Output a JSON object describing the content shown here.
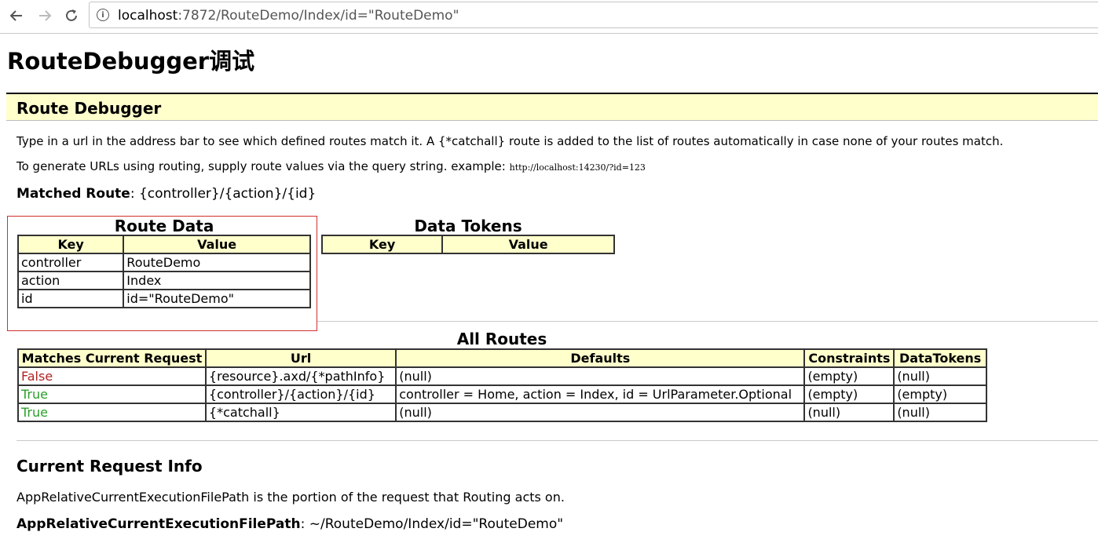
{
  "browser": {
    "url_host": "localhost",
    "url_rest": ":7872/RouteDemo/Index/id=\"RouteDemo\""
  },
  "page_title": "RouteDebugger调试",
  "route_debugger": {
    "heading": "Route Debugger",
    "intro": "Type in a url in the address bar to see which defined routes match it. A {*catchall} route is added to the list of routes automatically in case none of your routes match.",
    "gen_text": "To generate URLs using routing, supply route values via the query string. example: ",
    "gen_example": "http://localhost:14230/?id=123",
    "matched_label": "Matched Route",
    "matched_sep": ": ",
    "matched_value": "{controller}/{action}/{id}"
  },
  "route_data": {
    "caption": "Route Data",
    "headers": [
      "Key",
      "Value"
    ],
    "rows": [
      [
        "controller",
        "RouteDemo"
      ],
      [
        "action",
        "Index"
      ],
      [
        "id",
        "id=\"RouteDemo\""
      ]
    ]
  },
  "data_tokens": {
    "caption": "Data Tokens",
    "headers": [
      "Key",
      "Value"
    ]
  },
  "all_routes": {
    "caption": "All Routes",
    "headers": [
      "Matches Current Request",
      "Url",
      "Defaults",
      "Constraints",
      "DataTokens"
    ],
    "rows": [
      [
        "False",
        "{resource}.axd/{*pathInfo}",
        "(null)",
        "(empty)",
        "(null)"
      ],
      [
        "True",
        "{controller}/{action}/{id}",
        "controller = Home, action = Index, id = UrlParameter.Optional",
        "(empty)",
        "(empty)"
      ],
      [
        "True",
        "{*catchall}",
        "(null)",
        "(null)",
        "(null)"
      ]
    ],
    "true_color": "#2aa02a",
    "false_color": "#b22222"
  },
  "current_request": {
    "heading": "Current Request Info",
    "desc": "AppRelativeCurrentExecutionFilePath is the portion of the request that Routing acts on.",
    "label": "AppRelativeCurrentExecutionFilePath",
    "sep": ": ",
    "value": "~/RouteDemo/Index/id=\"RouteDemo\""
  },
  "colors": {
    "header_bg": "#ffffcc",
    "highlight_border": "#d03030"
  }
}
